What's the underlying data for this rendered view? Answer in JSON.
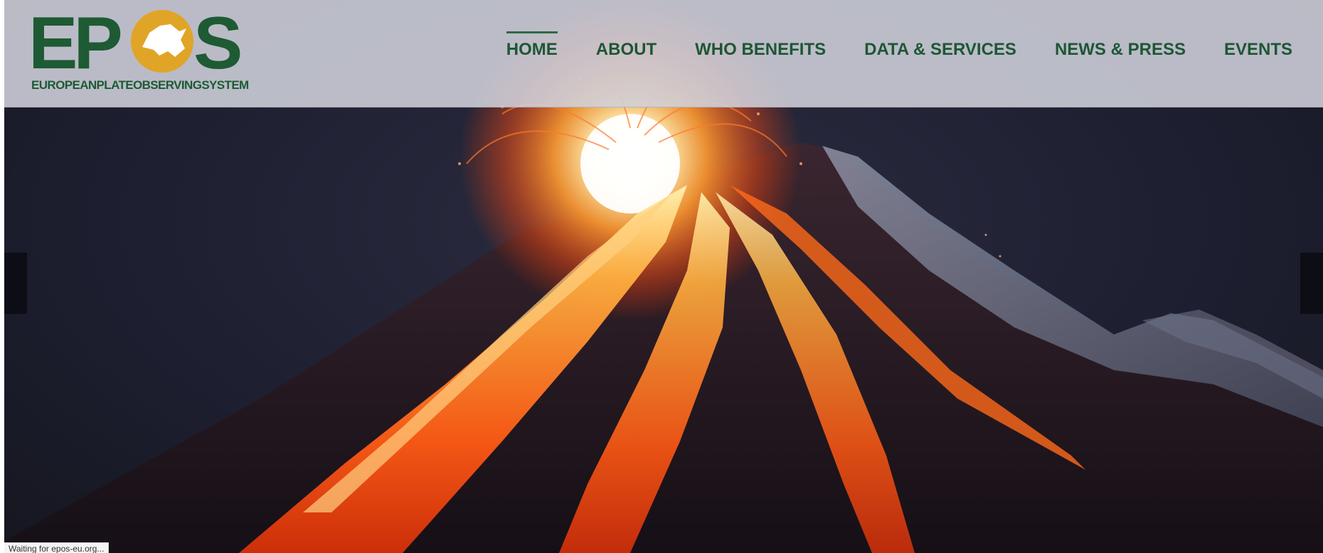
{
  "brand": {
    "logo_text_left": "EP",
    "logo_text_right": "S",
    "tagline": "EUROPEANPLATEOBSERVINGSYSTEM",
    "logo_green": "#1e5a34",
    "logo_gold": "#e0a526"
  },
  "nav": {
    "items": [
      {
        "label": "HOME",
        "active": true
      },
      {
        "label": "ABOUT"
      },
      {
        "label": "WHO BENEFITS"
      },
      {
        "label": "DATA & SERVICES"
      },
      {
        "label": "NEWS & PRESS"
      },
      {
        "label": "EVENTS"
      }
    ]
  },
  "hero": {
    "icons": {
      "prev": "slider-prev-icon",
      "next": "slider-next-icon"
    }
  },
  "status_bar": {
    "text": "Waiting for epos-eu.org..."
  },
  "colors": {
    "nav_text": "#1e5635",
    "header_bg": "#d0d2dc",
    "sky": "#1e2032",
    "lava": "#ff5a14"
  }
}
